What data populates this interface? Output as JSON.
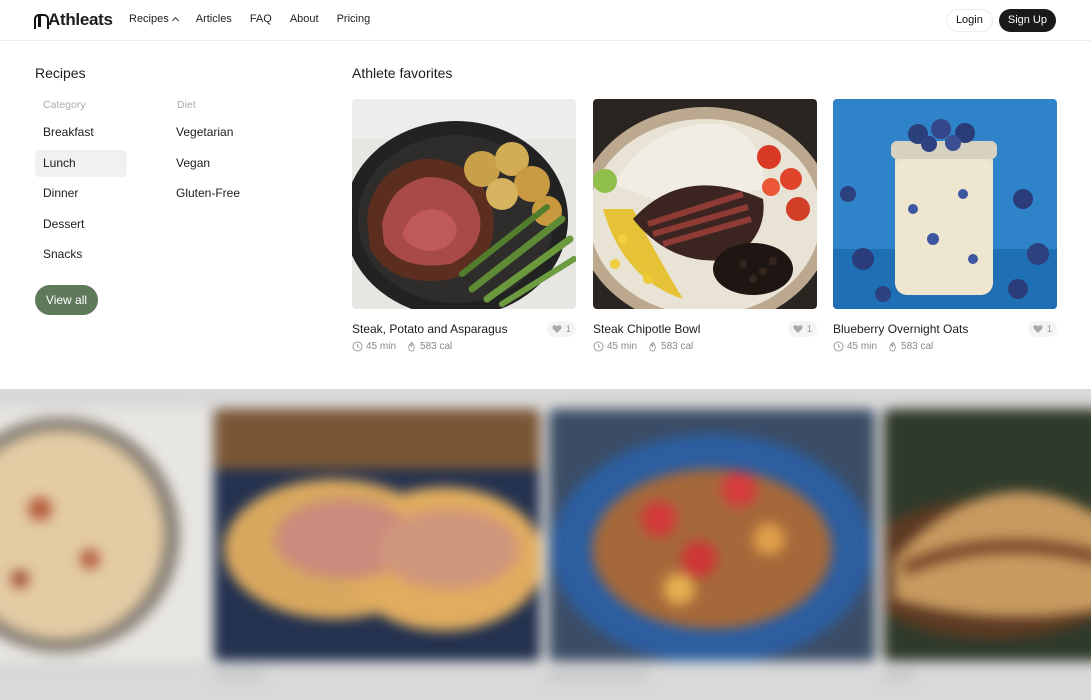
{
  "brand": {
    "name": "Athleats"
  },
  "nav": {
    "items": [
      {
        "label": "Recipes"
      },
      {
        "label": "Articles"
      },
      {
        "label": "FAQ"
      },
      {
        "label": "About"
      },
      {
        "label": "Pricing"
      }
    ],
    "login": "Login",
    "signup": "Sign Up"
  },
  "dropdown": {
    "title": "Recipes",
    "category_heading": "Category",
    "categories": [
      "Breakfast",
      "Lunch",
      "Dinner",
      "Dessert",
      "Snacks"
    ],
    "active_category": "Lunch",
    "diet_heading": "Diet",
    "diets": [
      "Vegetarian",
      "Vegan",
      "Gluten-Free"
    ],
    "view_all": "View all"
  },
  "favorites": {
    "title": "Athlete favorites",
    "cards": [
      {
        "name": "Steak, Potato and Asparagus",
        "likes": "1",
        "time": "45 min",
        "calories": "583 cal",
        "image": "steak-potato-asparagus-skillet"
      },
      {
        "name": "Steak Chipotle Bowl",
        "likes": "1",
        "time": "45 min",
        "calories": "583 cal",
        "image": "steak-chipotle-bowl"
      },
      {
        "name": "Blueberry Overnight Oats",
        "likes": "1",
        "time": "45 min",
        "calories": "583 cal",
        "image": "blueberry-oats-jar"
      }
    ]
  },
  "colors": {
    "accent": "#5f7a5b",
    "dark": "#1a1a1a"
  }
}
